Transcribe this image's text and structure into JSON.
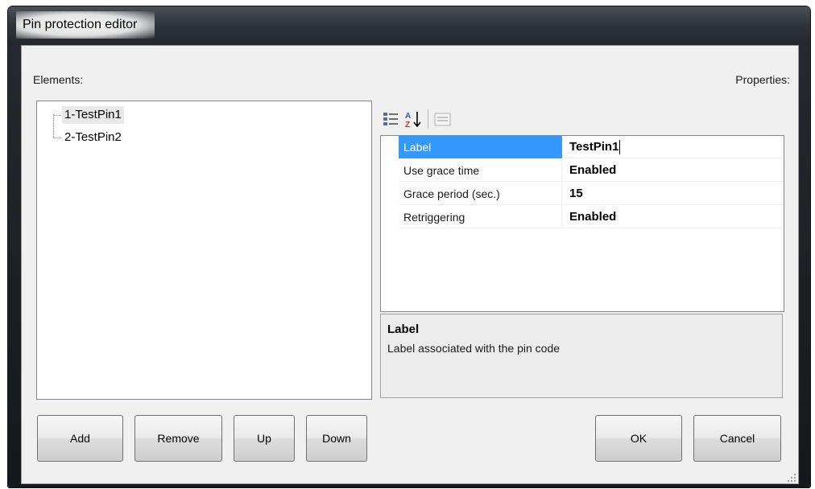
{
  "window": {
    "title": "Pin protection editor"
  },
  "labels": {
    "elements": "Elements:",
    "properties": "Properties:"
  },
  "tree": {
    "nodes": [
      {
        "label": "1-TestPin1",
        "selected": true
      },
      {
        "label": "2-TestPin2",
        "selected": false
      }
    ]
  },
  "toolbar": {
    "items": [
      {
        "icon": "categorized-view-icon"
      },
      {
        "icon": "alphabetical-sort-icon"
      },
      {
        "icon": "property-pages-icon"
      }
    ]
  },
  "property_grid": {
    "rows": [
      {
        "name": "Label",
        "value": "TestPin1",
        "selected": true
      },
      {
        "name": "Use grace time",
        "value": "Enabled",
        "selected": false
      },
      {
        "name": "Grace period (sec.)",
        "value": "15",
        "selected": false
      },
      {
        "name": "Retriggering",
        "value": "Enabled",
        "selected": false
      }
    ]
  },
  "help": {
    "title": "Label",
    "description": "Label associated with the pin code"
  },
  "buttons": {
    "add": "Add",
    "remove": "Remove",
    "up": "Up",
    "down": "Down",
    "ok": "OK",
    "cancel": "Cancel"
  },
  "colors": {
    "selection": "#3399ff",
    "title_bar": "#30353c"
  }
}
